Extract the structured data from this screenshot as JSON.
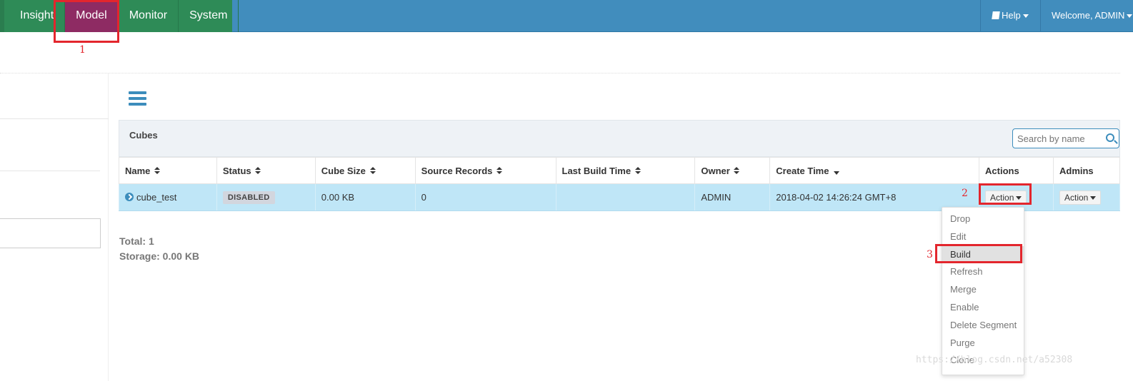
{
  "nav": {
    "items": [
      {
        "label": "Insight"
      },
      {
        "label": "Model"
      },
      {
        "label": "Monitor"
      },
      {
        "label": "System"
      }
    ],
    "active": "Model",
    "help_label": "Help",
    "welcome_label": "Welcome, ADMIN"
  },
  "annotations": {
    "n1": "1",
    "n2": "2",
    "n3": "3"
  },
  "panel": {
    "title": "Cubes",
    "search_placeholder": "Search by name"
  },
  "table": {
    "headers": [
      "Name",
      "Status",
      "Cube Size",
      "Source Records",
      "Last Build Time",
      "Owner",
      "Create Time",
      "Actions",
      "Admins"
    ],
    "rows": [
      {
        "name": "cube_test",
        "status": "DISABLED",
        "cube_size": "0.00 KB",
        "source_records": "0",
        "last_build_time": "",
        "owner": "ADMIN",
        "create_time": "2018-04-02 14:26:24 GMT+8",
        "action_label": "Action",
        "admin_action_label": "Action"
      }
    ]
  },
  "summary": {
    "total": "Total: 1",
    "storage": "Storage: 0.00 KB"
  },
  "action_menu": {
    "items": [
      "Drop",
      "Edit",
      "Build",
      "Refresh",
      "Merge",
      "Enable",
      "Delete Segment",
      "Purge",
      "Clone"
    ],
    "highlighted": "Build"
  },
  "watermark": "https://blog.csdn.net/a52308",
  "colors": {
    "topbar": "#418dbd",
    "nav_left": "#2e8b57",
    "nav_active": "#8e2b63",
    "row_selected": "#bfe6f7",
    "annotation": "#e3262d"
  }
}
